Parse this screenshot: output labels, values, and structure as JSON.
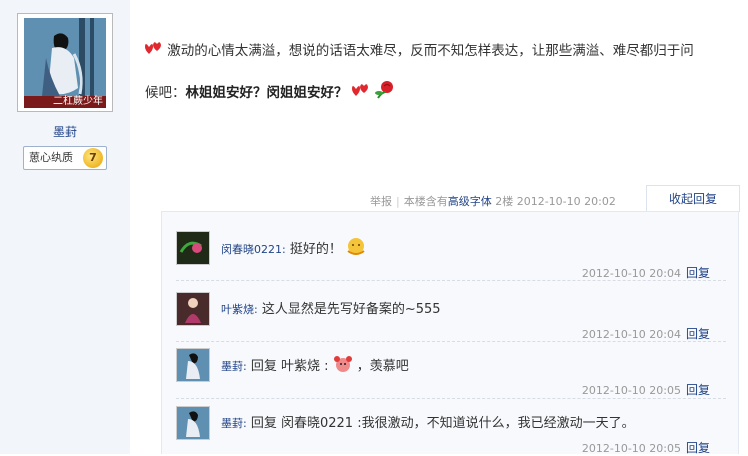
{
  "author": {
    "avatar_caption": "二杠蕨少年",
    "name": "墨葑",
    "badge_label": "葸心纨质",
    "badge_level": "7"
  },
  "post": {
    "text_line1": "激动的心情太满溢，想说的话语太难尽，反而不知怎样表达，让那些满溢、难尽都归于问",
    "text_line2_prefix": "候吧：",
    "text_line2_bold": "林姐姐安好？闵姐姐安好？"
  },
  "meta": {
    "report": "举报",
    "contains": "本楼含有",
    "font_link": "高级字体",
    "floor": "2楼",
    "timestamp": "2012-10-10 20:02",
    "collapse_label": "收起回复"
  },
  "replies": [
    {
      "name": "闵春晓0221:",
      "text": "挺好的！",
      "time": "2012-10-10 20:04",
      "reply_label": "回复"
    },
    {
      "name": "叶紫烧:",
      "text": "这人显然是先写好备案的~555",
      "time": "2012-10-10 20:04",
      "reply_label": "回复"
    },
    {
      "name": "墨葑:",
      "text_a": "回复 叶紫烧 :",
      "text_b": "，羡慕吧",
      "time": "2012-10-10 20:05",
      "reply_label": "回复"
    },
    {
      "name": "墨葑:",
      "text": "回复 闵春晓0221 :我很激动，不知道说什么，我已经激动一天了。",
      "time": "2012-10-10 20:05",
      "reply_label": "回复"
    }
  ],
  "colors": {
    "link": "#224488",
    "sidebar_bg": "#f2f5fa",
    "avatar_caption_bg": "#7b1a1a"
  }
}
